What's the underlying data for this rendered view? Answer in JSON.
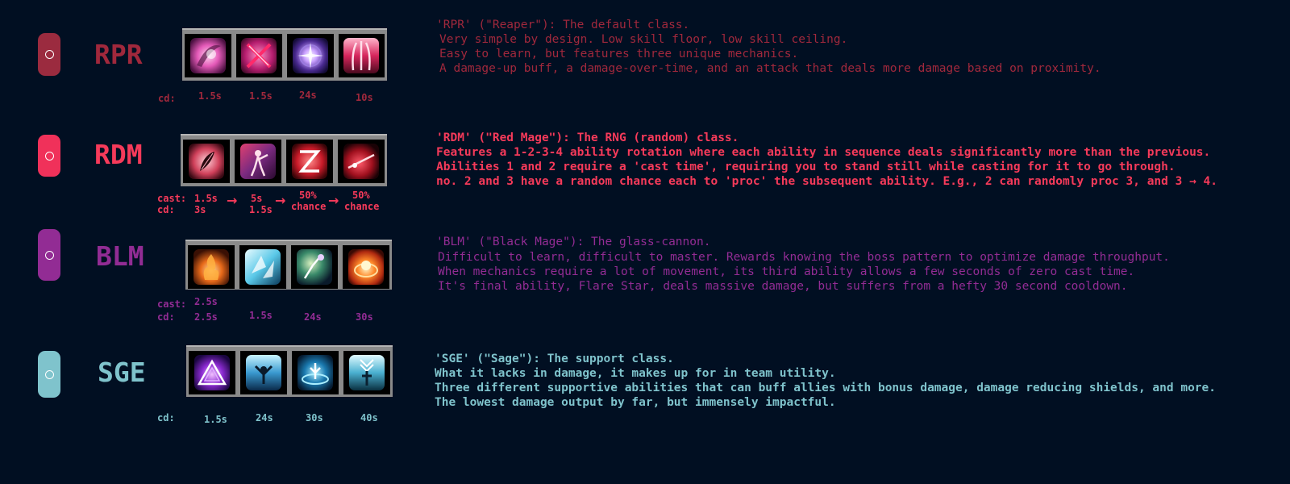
{
  "classes": {
    "rpr": {
      "abbr": "RPR",
      "color": "#a0283c",
      "icons": [
        "reaper-slash-icon",
        "reaper-cross-icon",
        "reaper-orb-icon",
        "reaper-claw-icon"
      ],
      "cd_label": "cd:",
      "cds": [
        "1.5s",
        "1.5s",
        "24s",
        "10s"
      ],
      "title": "'RPR' (\"Reaper\"): The default class.",
      "lines": [
        "Very simple by design. Low skill floor, low skill ceiling.",
        "Easy to learn, but features three unique mechanics.",
        "A damage-up buff, a damage-over-time, and an attack that deals more damage based on proximity."
      ]
    },
    "rdm": {
      "abbr": "RDM",
      "color": "#f63a5a",
      "icons": [
        "red-mage-rose-icon",
        "red-mage-figure-icon",
        "red-mage-zigzag-icon",
        "red-mage-rapier-icon"
      ],
      "cast_label": "cast:",
      "cd_label": "cd:",
      "casts": [
        "1.5s",
        "5s",
        "50%",
        "50%"
      ],
      "cds": [
        "3s",
        "1.5s",
        "chance",
        "chance"
      ],
      "arrow": "→",
      "title": "'RDM' (\"Red Mage\"): The RNG (random) class.",
      "lines": [
        "Features a 1-2-3-4 ability rotation where each ability in sequence deals significantly more than the previous.",
        "Abilities 1 and 2 require a 'cast time', requiring you to stand still while casting for it to go through.",
        "no. 2 and 3 have a random chance each to 'proc' the subsequent ability. E.g., 2 can randomly proc 3, and 3 → 4."
      ]
    },
    "blm": {
      "abbr": "BLM",
      "color": "#922c94",
      "icons": [
        "fire-icon",
        "ice-crystal-icon",
        "leyline-icon",
        "flare-star-icon"
      ],
      "cast_label": "cast:",
      "cd_label": "cd:",
      "cast_value": "2.5s",
      "cds": [
        "2.5s",
        "1.5s",
        "24s",
        "30s"
      ],
      "title": "'BLM' (\"Black Mage\"): The glass-cannon.",
      "lines": [
        "Difficult to learn, difficult to master. Rewards knowing the boss pattern to optimize damage throughput.",
        "When mechanics require a lot of movement, its third ability allows a few seconds of zero cast time.",
        "It's final ability, Flare Star, deals massive damage, but suffers from a hefty 30 second cooldown."
      ]
    },
    "sge": {
      "abbr": "SGE",
      "color": "#7fc3cc",
      "icons": [
        "sage-triangle-icon",
        "sage-raise-icon",
        "sage-shield-icon",
        "sage-pillar-icon"
      ],
      "cd_label": "cd:",
      "cds": [
        "1.5s",
        "24s",
        "30s",
        "40s"
      ],
      "title": "'SGE' (\"Sage\"): The support class.",
      "lines": [
        "What it lacks in damage, it makes up for in team utility.",
        "Three different supportive abilities that can buff allies with bonus damage, damage reducing shields, and more.",
        "The lowest damage output by far, but immensely impactful."
      ]
    }
  }
}
